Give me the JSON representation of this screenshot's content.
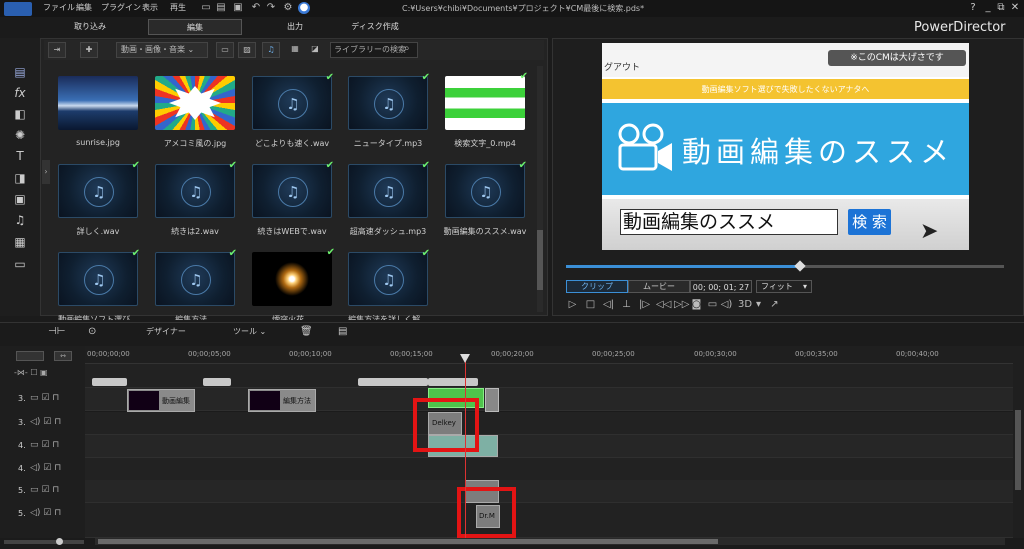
{
  "menu": [
    "ファイル",
    "編集",
    "プラグイン",
    "表示",
    "再生"
  ],
  "app_title": "C:¥Users¥chibi¥Documents¥プロジェクト¥CM最後に検索.pds*",
  "brand": "PowerDirector",
  "tabs": [
    "取り込み",
    "編集",
    "出力",
    "ディスク作成"
  ],
  "window_buttons": [
    "?",
    "_",
    "⧉",
    "✕"
  ],
  "library": {
    "filter": "動画・画像・音楽",
    "search_placeholder": "ライブラリーの検索",
    "items": [
      {
        "label": "sunrise.jpg",
        "kind": "image-sunrise",
        "checked": false
      },
      {
        "label": "アメコミ風の.jpg",
        "kind": "image-comic",
        "checked": false
      },
      {
        "label": "どこよりも速く.wav",
        "kind": "audio",
        "checked": true
      },
      {
        "label": "ニュータイプ.mp3",
        "kind": "audio",
        "checked": true
      },
      {
        "label": "検索文字_0.mp4",
        "kind": "video-green",
        "checked": true
      },
      {
        "label": "詳しく.wav",
        "kind": "audio",
        "checked": true
      },
      {
        "label": "続きは2.wav",
        "kind": "audio",
        "checked": true
      },
      {
        "label": "続きはWEBで.wav",
        "kind": "audio",
        "checked": true
      },
      {
        "label": "超高速ダッシュ.mp3",
        "kind": "audio",
        "checked": true
      },
      {
        "label": "動画編集のススメ.wav",
        "kind": "audio",
        "checked": true
      },
      {
        "label": "動画編集ソフト選び...",
        "kind": "audio",
        "checked": true
      },
      {
        "label": "編集方法...",
        "kind": "audio",
        "checked": true
      },
      {
        "label": "煙突火花...",
        "kind": "image-sparkle",
        "checked": true
      },
      {
        "label": "編集方法を詳しく解...",
        "kind": "audio",
        "checked": true
      }
    ]
  },
  "preview": {
    "top_text": "グアウト",
    "yellow_text": "動画編集ソフト選びで失敗したくないアナタへ",
    "title": "動画編集のススメ",
    "search_text": "動画編集のススメ",
    "search_button": "検 索",
    "badge": "※このCMは大げさです",
    "clip_label": "クリップ",
    "movie_label": "ムービー",
    "timecode": "00; 00; 01; 27",
    "fit": "フィット",
    "seek_fraction": 0.53,
    "three_d": "3D"
  },
  "toolbar": {
    "designer": "デザイナー",
    "tools": "ツール"
  },
  "ruler": [
    "00;00;00;00",
    "00;00;05;00",
    "00;00;10;00",
    "00;00;15;00",
    "00;00;20;00",
    "00;00;25;00",
    "00;00;30;00",
    "00;00;35;00",
    "00;00;40;00"
  ],
  "tracks": [
    {
      "label": "3.",
      "type": "video"
    },
    {
      "label": "3.",
      "type": "audio"
    },
    {
      "label": "4.",
      "type": "video"
    },
    {
      "label": "4.",
      "type": "audio"
    },
    {
      "label": "5.",
      "type": "video"
    },
    {
      "label": "5.",
      "type": "audio"
    }
  ],
  "clips": {
    "c1": "動画編集",
    "c2": "編集方法",
    "c3": "Delkey",
    "c4": "Dr.M"
  },
  "colors": {
    "accent": "#3b8fd6",
    "highlight_box": "#e31414",
    "check": "#6cf06c"
  }
}
